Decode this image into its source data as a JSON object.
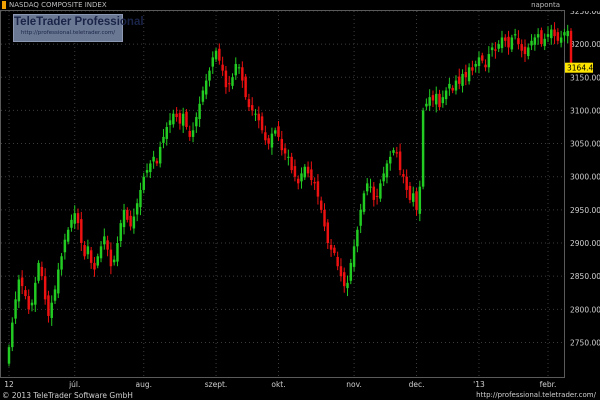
{
  "header": {
    "title": "NASDAQ COMPOSITE INDEX",
    "period": "naponta",
    "accent_color": "#f0a000"
  },
  "logo": {
    "name": "TeleTrader Professional",
    "url": "http://professional.teletrader.com/",
    "background_color": "#6b7893"
  },
  "footer": {
    "copyright": "© 2013 TeleTrader Software GmbH",
    "url": "http://professional.teletrader.com/"
  },
  "chart_data": {
    "type": "candlestick",
    "title": "NASDAQ COMPOSITE INDEX",
    "ylim": [
      2710,
      3265
    ],
    "y_ticks": [
      2750,
      2800,
      2850,
      2900,
      2950,
      3000,
      3050,
      3100,
      3150,
      3200,
      3250
    ],
    "y_tick_labels": [
      "2750.00",
      "2800.00",
      "2850.00",
      "2900.00",
      "2950.00",
      "3000.00",
      "3050.00",
      "3100.00",
      "3150.00",
      "3200.00",
      "3250.00"
    ],
    "x_ticks": [
      {
        "label": "12",
        "index": 0
      },
      {
        "label": "júl.",
        "index": 20
      },
      {
        "label": "aug.",
        "index": 41
      },
      {
        "label": "szept.",
        "index": 63
      },
      {
        "label": "okt.",
        "index": 82
      },
      {
        "label": "nov.",
        "index": 105
      },
      {
        "label": "dec.",
        "index": 124
      },
      {
        "label": "'13",
        "index": 143
      },
      {
        "label": "febr.",
        "index": 164
      }
    ],
    "last_value": 3164.41,
    "last_value_label": "3164.41",
    "grid": true,
    "up_color": "#22cc22",
    "down_color": "#ee1111",
    "candle_count": 176,
    "closes": [
      2743,
      2780,
      2815,
      2845,
      2835,
      2820,
      2800,
      2810,
      2840,
      2870,
      2850,
      2815,
      2790,
      2810,
      2830,
      2860,
      2880,
      2905,
      2920,
      2935,
      2945,
      2930,
      2900,
      2880,
      2895,
      2870,
      2860,
      2880,
      2895,
      2910,
      2890,
      2865,
      2875,
      2900,
      2930,
      2950,
      2935,
      2925,
      2940,
      2960,
      2980,
      3000,
      3010,
      3020,
      3030,
      3020,
      3045,
      3060,
      3075,
      3085,
      3095,
      3090,
      3080,
      3095,
      3075,
      3060,
      3070,
      3090,
      3110,
      3130,
      3145,
      3160,
      3180,
      3190,
      3175,
      3160,
      3135,
      3140,
      3150,
      3170,
      3165,
      3145,
      3120,
      3105,
      3100,
      3095,
      3085,
      3070,
      3055,
      3050,
      3065,
      3070,
      3060,
      3040,
      3035,
      3030,
      3010,
      3000,
      2990,
      3005,
      3015,
      3005,
      2995,
      2990,
      2970,
      2950,
      2925,
      2900,
      2890,
      2885,
      2865,
      2850,
      2835,
      2840,
      2870,
      2895,
      2920,
      2950,
      2975,
      2990,
      2985,
      2965,
      2970,
      2990,
      3005,
      3020,
      3030,
      3040,
      3035,
      3010,
      3000,
      2980,
      2965,
      2975,
      2950,
      2985,
      3100,
      3110,
      3120,
      3115,
      3125,
      3105,
      3120,
      3130,
      3140,
      3130,
      3145,
      3140,
      3155,
      3150,
      3165,
      3160,
      3170,
      3180,
      3175,
      3165,
      3185,
      3195,
      3190,
      3200,
      3210,
      3205,
      3195,
      3210,
      3215,
      3200,
      3190,
      3185,
      3195,
      3205,
      3210,
      3215,
      3200,
      3208,
      3215,
      3222,
      3212,
      3205,
      3210,
      3218,
      3220,
      3164
    ]
  }
}
